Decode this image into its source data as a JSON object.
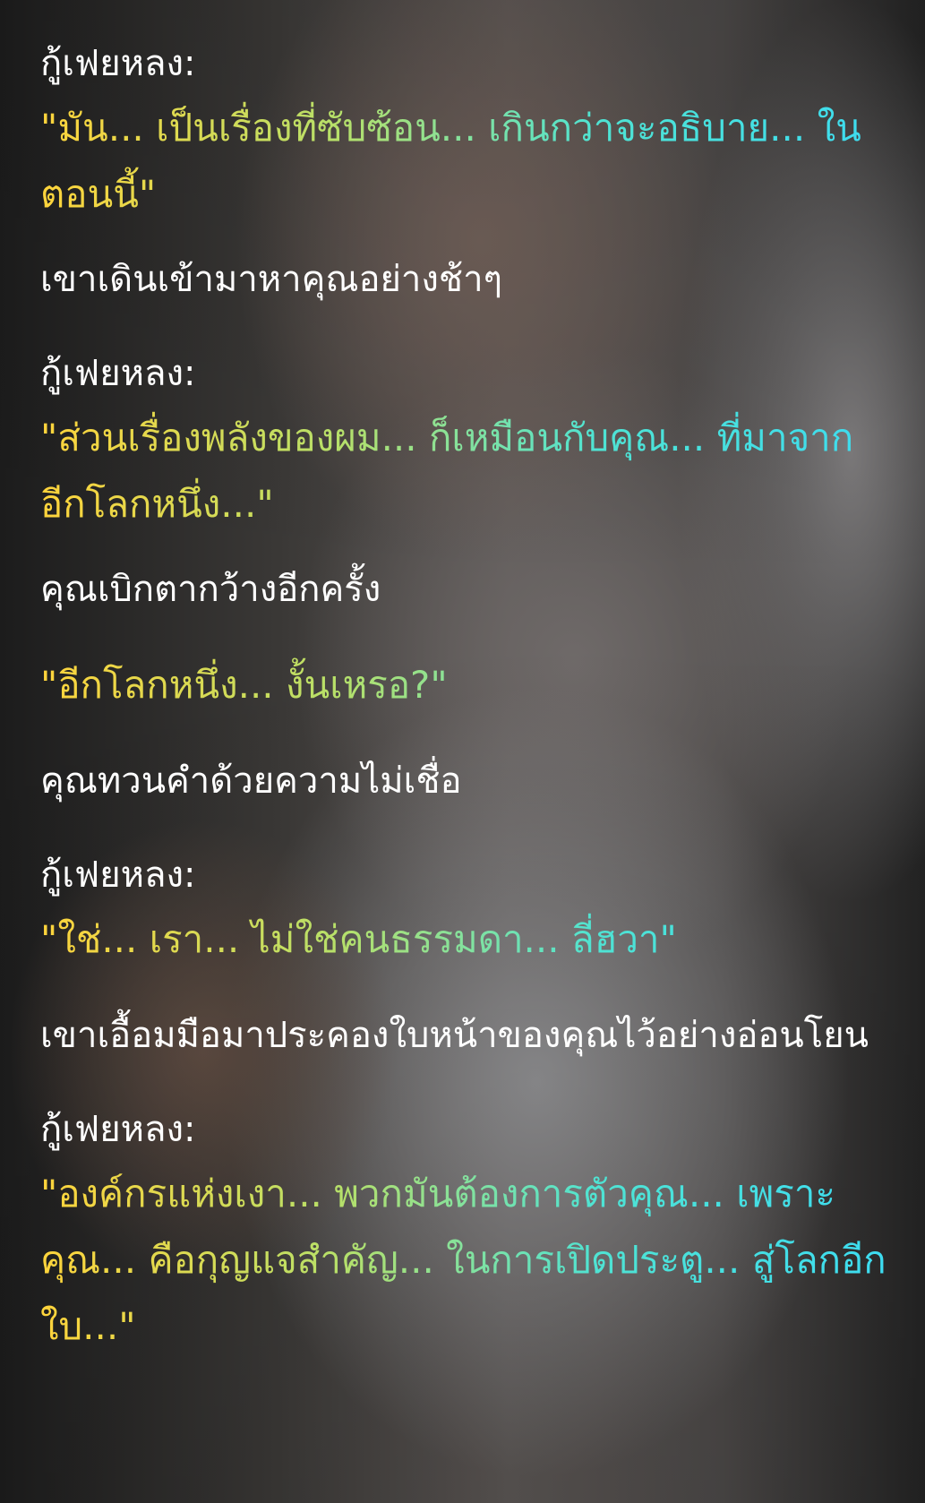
{
  "messages": [
    {
      "speaker": "กู้เฟยหลง:",
      "text": "\"มัน... เป็นเรื่องที่ซับซ้อน... เกินกว่าจะอธิบาย... ในตอนนี้\""
    },
    {
      "narration": "เขาเดินเข้ามาหาคุณอย่างช้าๆ"
    },
    {
      "speaker": "กู้เฟยหลง:",
      "text": "\"ส่วนเรื่องพลังของผม... ก็เหมือนกับคุณ... ที่มาจากอีกโลกหนึ่ง...\""
    },
    {
      "narration": "คุณเบิกตากว้างอีกครั้ง"
    },
    {
      "text": "\"อีกโลกหนึ่ง... งั้นเหรอ?\""
    },
    {
      "narration": "คุณทวนคำด้วยความไม่เชื่อ"
    },
    {
      "speaker": "กู้เฟยหลง:",
      "text": "\"ใช่... เรา... ไม่ใช่คนธรรมดา... ลี่ฮวา\""
    },
    {
      "narration": "เขาเอื้อมมือมาประคองใบหน้าของคุณไว้อย่างอ่อนโยน"
    },
    {
      "speaker": "กู้เฟยหลง:",
      "text": "\"องค์กรแห่งเงา... พวกมันต้องการตัวคุณ... เพราะคุณ... คือกุญแจสำคัญ... ในการเปิดประตู... สู่โลกอีกใบ...\""
    }
  ]
}
